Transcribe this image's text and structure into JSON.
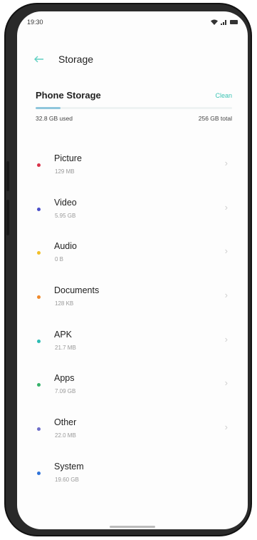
{
  "status_bar": {
    "time": "19:30"
  },
  "header": {
    "back_icon": "arrow-left-icon",
    "title": "Storage"
  },
  "storage": {
    "title": "Phone Storage",
    "clean_label": "Clean",
    "used_label": "32.8 GB used",
    "total_label": "256 GB total",
    "used_fraction": 0.128,
    "bar_color": "#8fc6dc"
  },
  "items": [
    {
      "name": "Picture",
      "size": "129 MB",
      "color": "#d9334a",
      "chevron": true
    },
    {
      "name": "Video",
      "size": "5.95 GB",
      "color": "#4b4fc9",
      "chevron": true
    },
    {
      "name": "Audio",
      "size": "0 B",
      "color": "#f2bf29",
      "chevron": true
    },
    {
      "name": "Documents",
      "size": "128 KB",
      "color": "#f08a2c",
      "chevron": true
    },
    {
      "name": "APK",
      "size": "21.7 MB",
      "color": "#2cbcb4",
      "chevron": true
    },
    {
      "name": "Apps",
      "size": "7.09 GB",
      "color": "#36b26a",
      "chevron": true
    },
    {
      "name": "Other",
      "size": "22.0 MB",
      "color": "#6e6ec9",
      "chevron": true
    },
    {
      "name": "System",
      "size": "19.60 GB",
      "color": "#2f73d9",
      "chevron": false
    }
  ]
}
